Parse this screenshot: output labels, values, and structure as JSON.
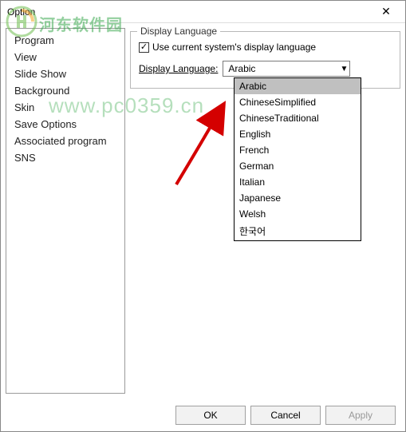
{
  "window": {
    "title": "Option"
  },
  "sidebar": {
    "items": [
      {
        "label": "Program"
      },
      {
        "label": "View"
      },
      {
        "label": "Slide Show"
      },
      {
        "label": "Background"
      },
      {
        "label": "Skin"
      },
      {
        "label": "Save Options"
      },
      {
        "label": "Associated program"
      },
      {
        "label": "SNS"
      }
    ]
  },
  "main": {
    "fieldset_title": "Display Language",
    "checkbox_label": "Use current system's display language",
    "checkbox_checked": "✓",
    "select_label": "Display Language:",
    "select_value": "Arabic",
    "dropdown": [
      "Arabic",
      "ChineseSimplified",
      "ChineseTraditional",
      "English",
      "French",
      "German",
      "Italian",
      "Japanese",
      "Welsh",
      "한국어"
    ]
  },
  "buttons": {
    "ok": "OK",
    "cancel": "Cancel",
    "apply": "Apply"
  },
  "watermark": {
    "site_name": "河东软件园",
    "url": "www.pc0359.cn"
  }
}
